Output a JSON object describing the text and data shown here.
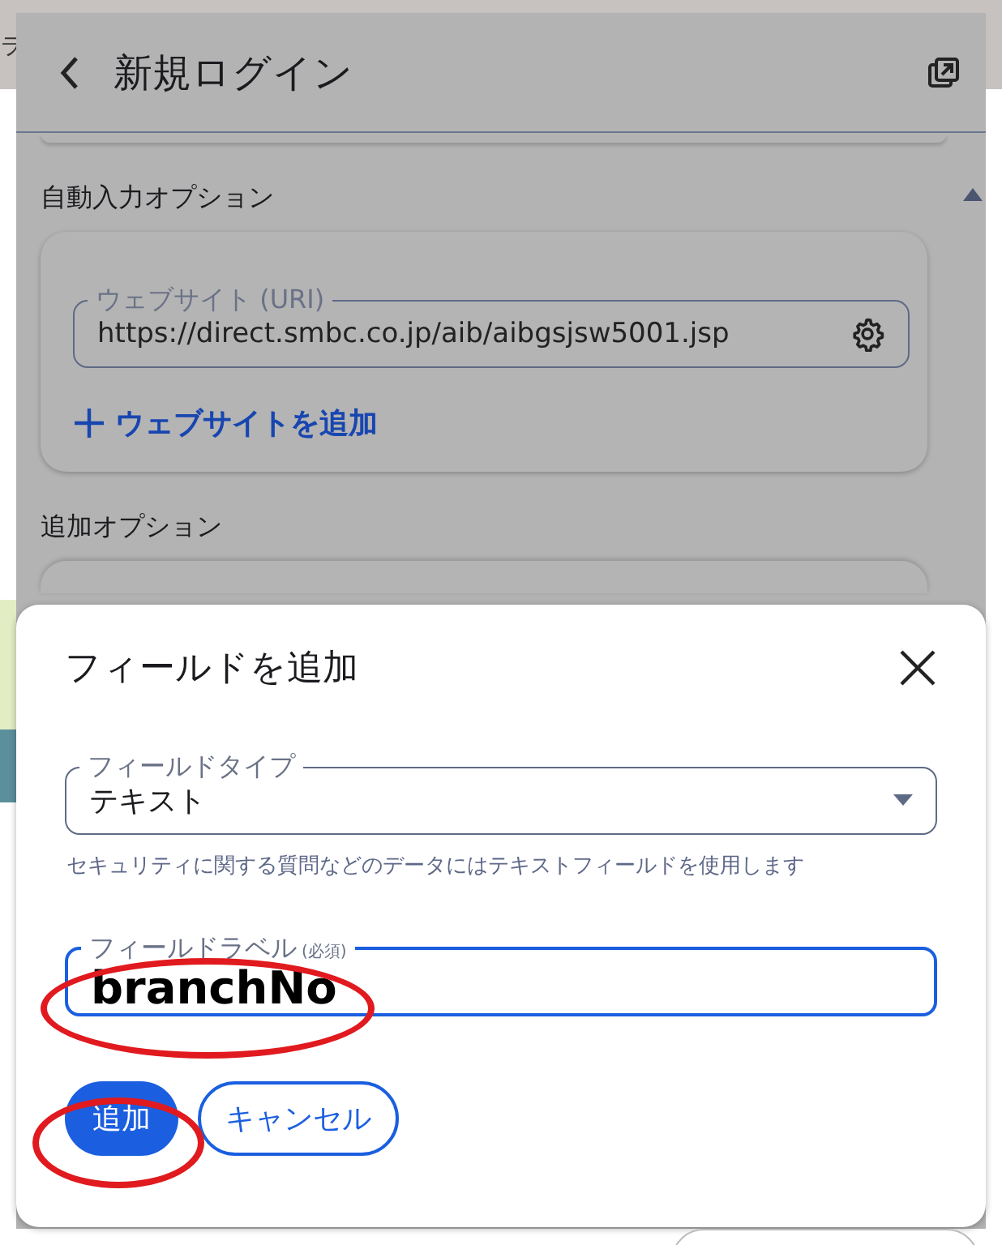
{
  "background_page": {
    "fragment_text": "ラ"
  },
  "panel": {
    "title": "新規ログイン",
    "autofill_section": {
      "heading": "自動入力オプション",
      "website_field": {
        "label": "ウェブサイト (URI)",
        "value": "https://direct.smbc.co.jp/aib/aibgsjsw5001.jsp"
      },
      "add_website": "ウェブサイトを追加"
    },
    "extra_options_heading": "追加オプション"
  },
  "dialog": {
    "title": "フィールドを追加",
    "field_type": {
      "label": "フィールドタイプ",
      "value": "テキスト",
      "helper": "セキュリティに関する質問などのデータにはテキストフィールドを使用します",
      "focused": false
    },
    "field_label": {
      "label": "フィールドラベル",
      "required": "(必須)",
      "value": "branchNo",
      "focused": true
    },
    "buttons": [
      {
        "label": "追加",
        "kind": "primary"
      },
      {
        "label": "キャンセル",
        "kind": "secondary"
      }
    ]
  }
}
